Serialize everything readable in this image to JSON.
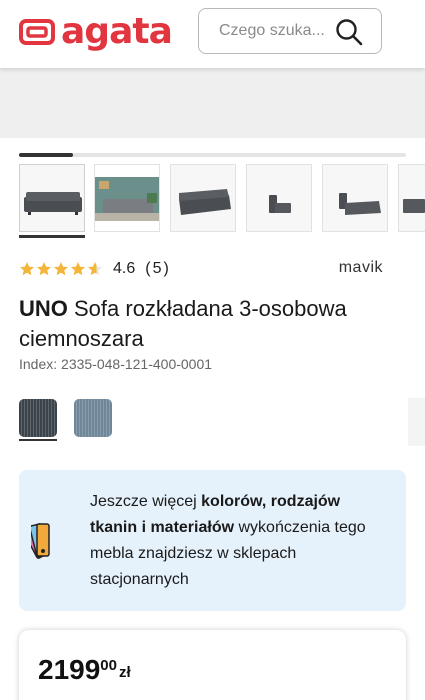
{
  "header": {
    "logo_text": "agata",
    "search_placeholder": "Czego szuka..."
  },
  "gallery": {
    "progress": 0.14,
    "thumbnails": [
      "sofa-front",
      "sofa-living-room",
      "sofa-angle",
      "sofa-side-open",
      "sofa-bed-open",
      "sofa-partial"
    ],
    "active_thumbnail": 0
  },
  "product": {
    "rating_value": "4.6",
    "rating_count": "(5)",
    "rating_stars": 4.6,
    "brand": "mavik",
    "name_bold": "UNO",
    "name_rest": " Sofa rozkładana 3-osobowa ciemnoszara",
    "index": "Index: 2335-048-121-400-0001"
  },
  "swatches": [
    {
      "color": "#3b434b",
      "selected": true
    },
    {
      "color": "#6f8799",
      "selected": false
    }
  ],
  "info": {
    "text_1": "Jeszcze więcej ",
    "text_bold_1": "kolorów, rodzajów tkanin i materiałów",
    "text_2": " wykończenia tego mebla znajdziesz w sklepach stacjonarnych"
  },
  "price": {
    "main": "2199",
    "cents": "00",
    "currency": "zł"
  },
  "colors": {
    "brand": "#e1353f",
    "star": "#f4b63a",
    "info_bg": "#e6f2fb"
  }
}
